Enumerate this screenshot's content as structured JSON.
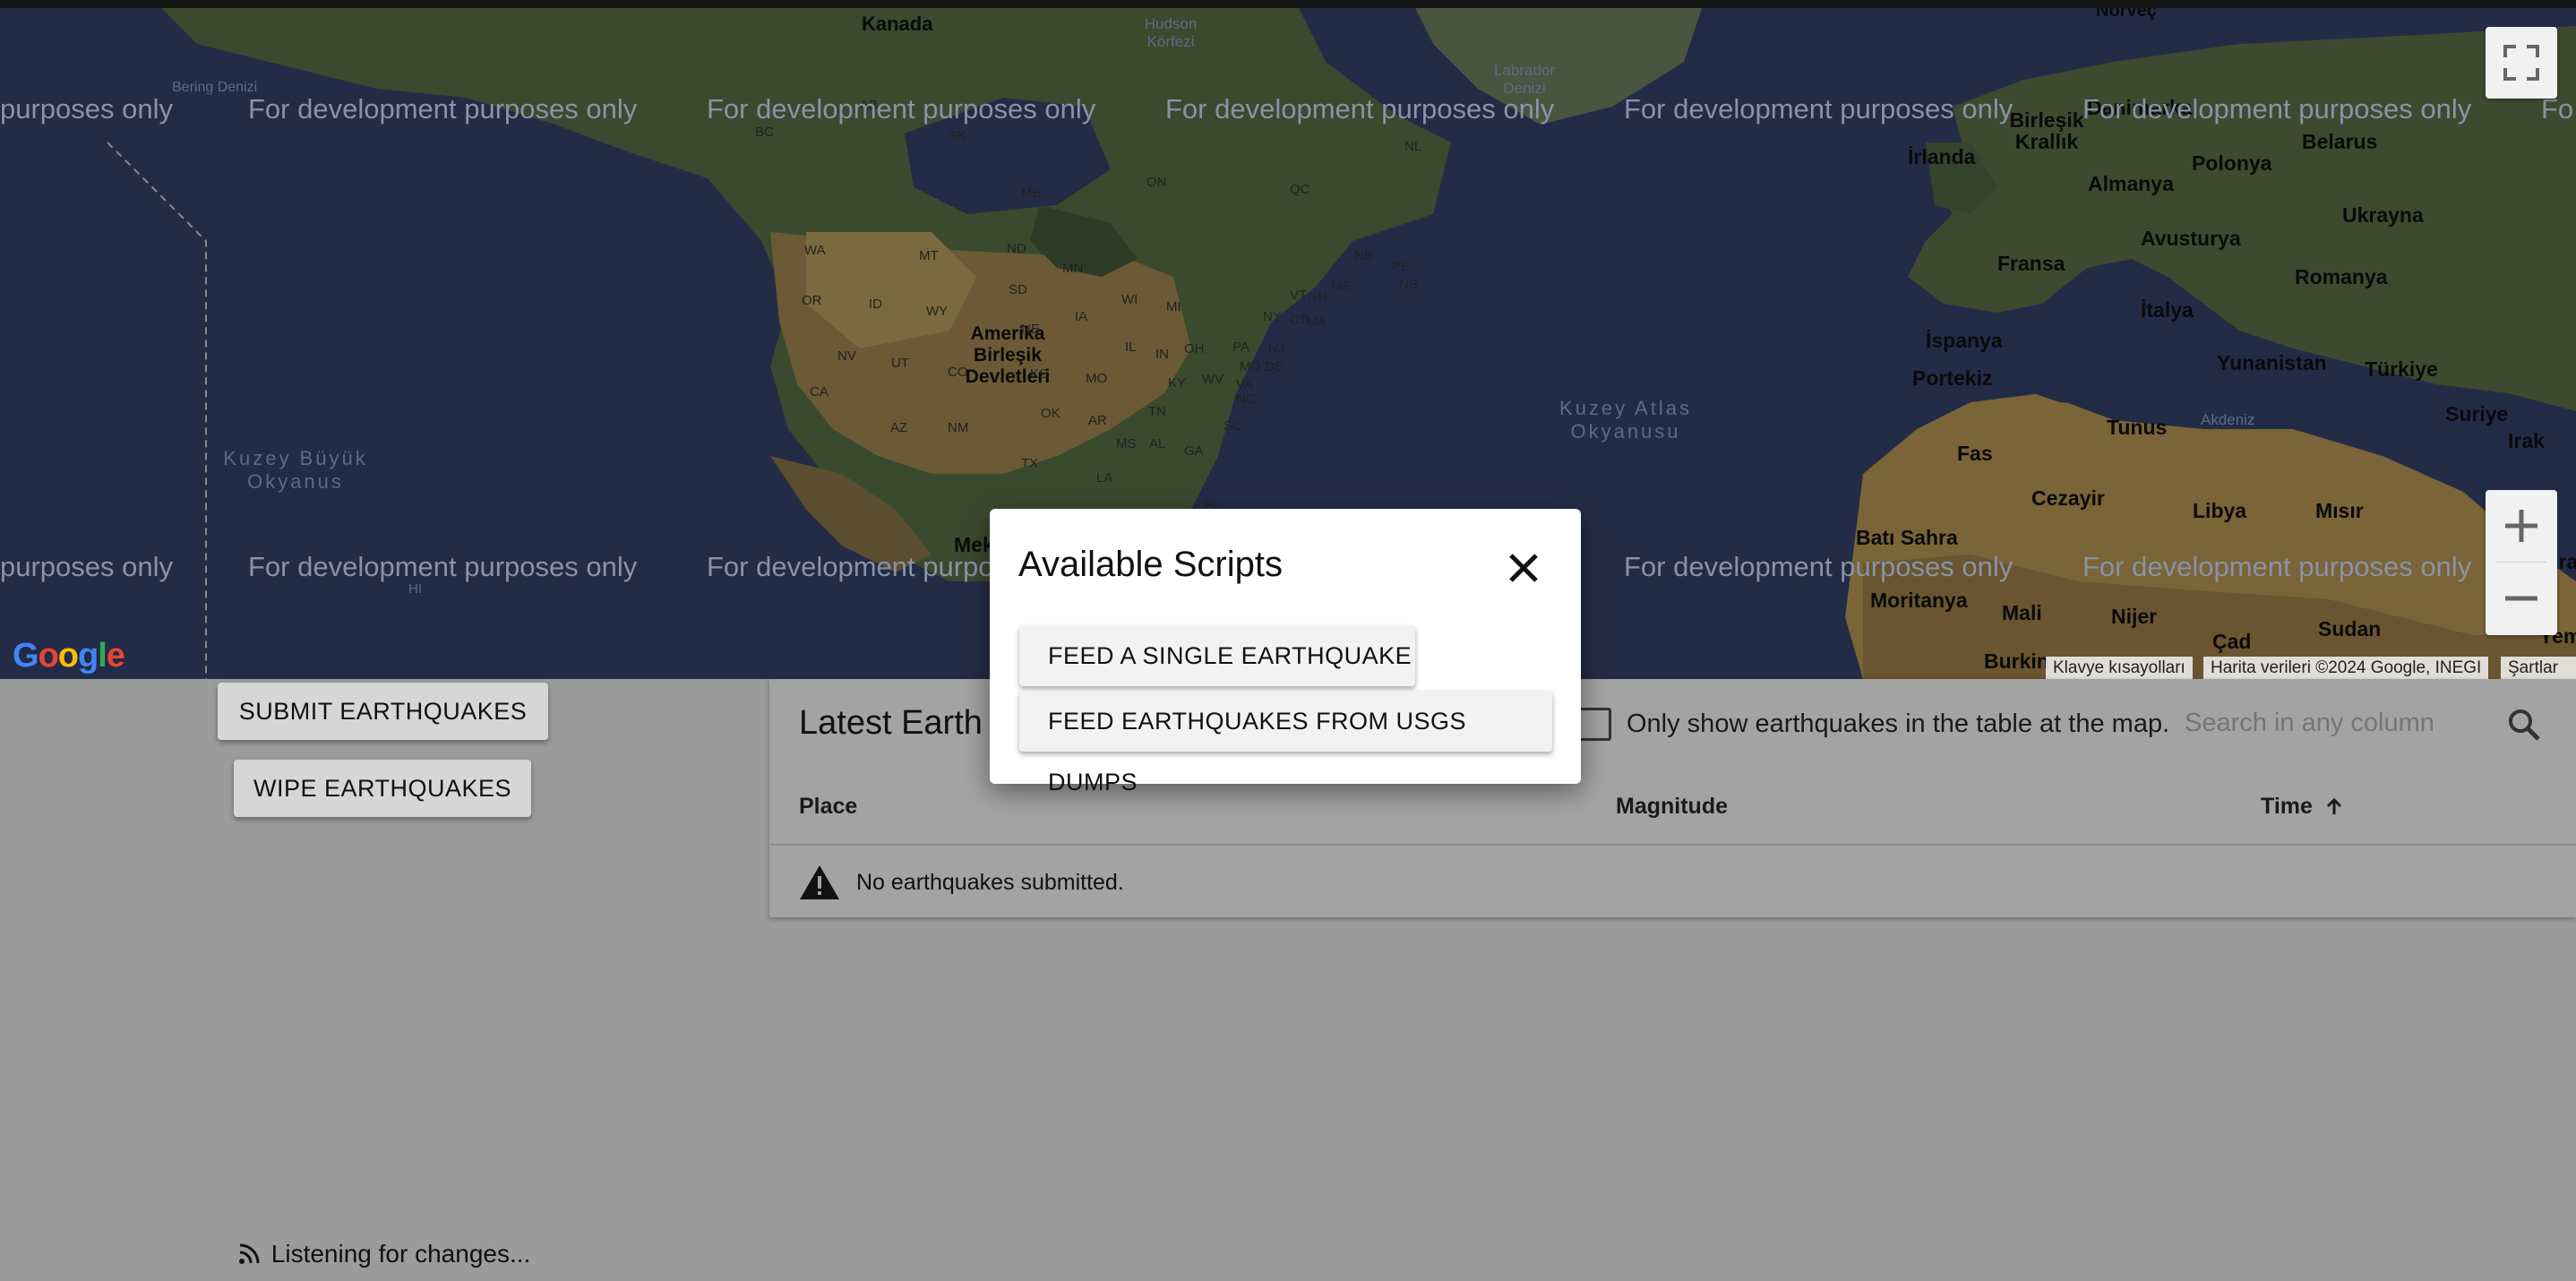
{
  "map": {
    "labels": {
      "kanada": "Kanada",
      "hudson": "Hudson Körfezi",
      "labrador": "Labrador Denizi",
      "bering": "Bering Denizi",
      "norvec": "Norveç",
      "abd": "Amerika Birleşik Devletleri",
      "pacific": "Kuzey Büyük Okyanus",
      "atlantic": "Kuzey Atlas Okyanusu",
      "irlanda": "İrlanda",
      "birlesik_krallik": "Birleşik Krallık",
      "danimarka": "Danimarka",
      "belarus": "Belarus",
      "almanya": "Almanya",
      "polonya": "Polonya",
      "ukrayna": "Ukrayna",
      "fransa": "Fransa",
      "avusturya": "Avusturya",
      "romanya": "Romanya",
      "italya": "İtalya",
      "ispanya": "İspanya",
      "portekiz": "Portekiz",
      "yunanistan": "Yunanistan",
      "turkiye": "Türkiye",
      "suriye": "Suriye",
      "irak": "Irak",
      "tunus": "Tunus",
      "akdeniz": "Akdeniz",
      "fas": "Fas",
      "cezayir": "Cezayir",
      "libya": "Libya",
      "misir": "Mısır",
      "bati_sahra": "Batı Sahra",
      "moritanya": "Moritanya",
      "mali": "Mali",
      "nijer": "Nijer",
      "cad": "Çad",
      "sudan": "Sudan",
      "burkina": "Burkin",
      "meksika": "Mek",
      "hi": "HI",
      "yemen": "Yemen",
      "ara": "Ara"
    },
    "states": [
      "WA",
      "OR",
      "ID",
      "MT",
      "ND",
      "SD",
      "NE",
      "WY",
      "NV",
      "UT",
      "CO",
      "CA",
      "AZ",
      "NM",
      "TX",
      "OK",
      "KS",
      "MN",
      "IA",
      "MO",
      "AR",
      "LA",
      "MS",
      "AL",
      "GA",
      "FL",
      "SC",
      "NC",
      "TN",
      "KY",
      "IL",
      "IN",
      "OH",
      "MI",
      "WI",
      "PA",
      "NY",
      "VA",
      "WV",
      "MD",
      "DE",
      "NJ",
      "CT",
      "MA",
      "VT",
      "NH",
      "ME",
      "ON",
      "QC",
      "MB",
      "SK",
      "AB",
      "BC",
      "NB",
      "PE",
      "NS",
      "NL"
    ],
    "watermark": "For development purposes only",
    "watermark_partial": "purposes only",
    "watermark_partial2": "For development purpos",
    "watermark_edge": "Fo",
    "google_logo": "Google",
    "attribution": {
      "shortcuts": "Klavye kısayolları",
      "data": "Harita verileri ©2024 Google, INEGI",
      "terms": "Şartlar"
    }
  },
  "sidebar": {
    "submit_label": "SUBMIT EARTHQUAKES",
    "wipe_label": "WIPE EARTHQUAKES"
  },
  "table": {
    "title": "Latest Earth",
    "checkbox_label": "Only show earthquakes in the table at the map.",
    "search_placeholder": "Search in any column",
    "columns": [
      "Place",
      "Magnitude",
      "Time"
    ],
    "empty_message": "No earthquakes submitted."
  },
  "status": {
    "listening": "Listening for changes..."
  },
  "modal": {
    "title": "Available Scripts",
    "buttons": [
      "FEED A SINGLE EARTHQUAKE",
      "FEED EARTHQUAKES FROM USGS DUMPS"
    ]
  }
}
